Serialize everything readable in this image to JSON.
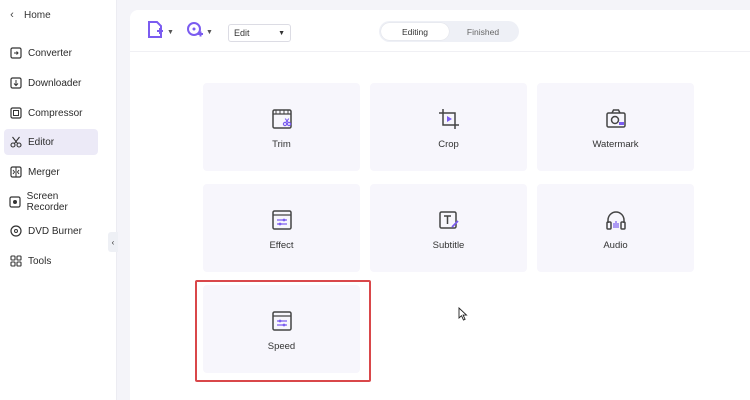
{
  "sidebar": {
    "home_label": "Home",
    "items": [
      {
        "label": "Converter",
        "icon": "converter-icon"
      },
      {
        "label": "Downloader",
        "icon": "downloader-icon"
      },
      {
        "label": "Compressor",
        "icon": "compressor-icon"
      },
      {
        "label": "Editor",
        "icon": "editor-scissors-icon",
        "active": true
      },
      {
        "label": "Merger",
        "icon": "merger-icon"
      },
      {
        "label": "Screen Recorder",
        "icon": "screen-recorder-icon"
      },
      {
        "label": "DVD Burner",
        "icon": "dvd-burner-icon"
      },
      {
        "label": "Tools",
        "icon": "tools-grid-icon"
      }
    ]
  },
  "toolbar": {
    "mode_select": "Edit",
    "tabs": [
      {
        "label": "Editing",
        "selected": true
      },
      {
        "label": "Finished",
        "selected": false
      }
    ]
  },
  "tools": [
    {
      "label": "Trim",
      "icon": "trim-icon"
    },
    {
      "label": "Crop",
      "icon": "crop-icon"
    },
    {
      "label": "Watermark",
      "icon": "watermark-icon"
    },
    {
      "label": "Effect",
      "icon": "effect-icon"
    },
    {
      "label": "Subtitle",
      "icon": "subtitle-icon"
    },
    {
      "label": "Audio",
      "icon": "audio-headphones-icon"
    },
    {
      "label": "Speed",
      "icon": "speed-icon",
      "highlighted": true
    }
  ],
  "colors": {
    "accent": "#7b5cf0",
    "highlight_border": "#d9474a",
    "active_nav_bg": "#eceaf7"
  }
}
